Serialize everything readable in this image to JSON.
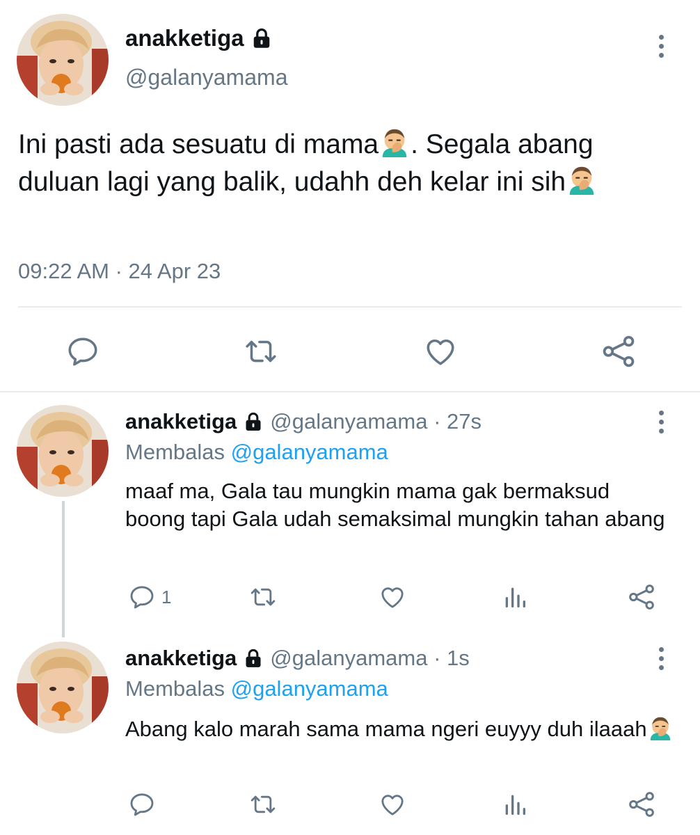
{
  "main_tweet": {
    "display_name": "anakketiga",
    "handle": "@galanyamama",
    "text_part1": "Ini pasti ada sesuatu di mama",
    "emoji1": "facepalm-emoji",
    "text_part2": ". Segala abang duluan lagi yang balik, udahh deh kelar ini sih",
    "emoji2": "facepalm-emoji",
    "timestamp": "09:22 AM · 24 Apr 23",
    "actions": [
      "reply-icon",
      "retweet-icon",
      "like-icon",
      "share-icon"
    ]
  },
  "replies": [
    {
      "display_name": "anakketiga",
      "handle_time": "@galanyamama · 27s",
      "replying_prefix": "Membalas ",
      "replying_to": "@galanyamama",
      "text": "maaf ma, Gala tau mungkin mama gak bermaksud boong tapi Gala udah semaksimal mungkin tahan abang",
      "reply_count": "1"
    },
    {
      "display_name": "anakketiga",
      "handle_time": "@galanyamama · 1s",
      "replying_prefix": "Membalas ",
      "replying_to": "@galanyamama",
      "text": "Abang kalo marah sama mama ngeri euyyy duh ilaaah",
      "emoji": "facepalm-emoji",
      "reply_count": ""
    }
  ],
  "colors": {
    "text": "#0f1419",
    "secondary": "#657786",
    "link": "#1da1f2",
    "divider": "#e6ecf0"
  }
}
